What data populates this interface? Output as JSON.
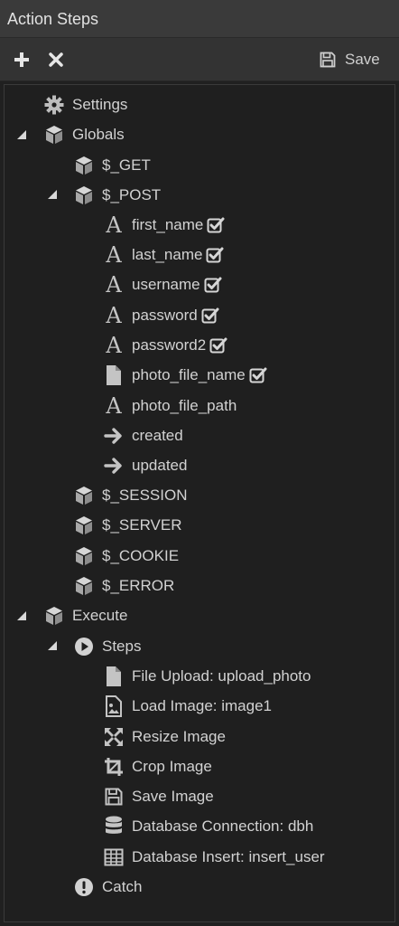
{
  "panel": {
    "title": "Action Steps"
  },
  "toolbar": {
    "save_label": "Save"
  },
  "tree": {
    "settings": "Settings",
    "globals": "Globals",
    "get": "$_GET",
    "post": "$_POST",
    "post_fields": [
      {
        "label": "first_name",
        "checked": true
      },
      {
        "label": "last_name",
        "checked": true
      },
      {
        "label": "username",
        "checked": true
      },
      {
        "label": "password",
        "checked": true
      },
      {
        "label": "password2",
        "checked": true
      },
      {
        "label": "photo_file_name",
        "checked": true
      },
      {
        "label": "photo_file_path",
        "checked": false
      },
      {
        "label": "created",
        "checked": false
      },
      {
        "label": "updated",
        "checked": false
      }
    ],
    "session": "$_SESSION",
    "server": "$_SERVER",
    "cookie": "$_COOKIE",
    "error": "$_ERROR",
    "execute": "Execute",
    "steps": "Steps",
    "step_items": [
      {
        "label": "File Upload: upload_photo",
        "icon": "file-icon"
      },
      {
        "label": "Load Image: image1",
        "icon": "image-icon"
      },
      {
        "label": "Resize Image",
        "icon": "resize-icon"
      },
      {
        "label": "Crop Image",
        "icon": "crop-icon"
      },
      {
        "label": "Save Image",
        "icon": "floppy-icon"
      },
      {
        "label": "Database Connection: dbh",
        "icon": "database-icon"
      },
      {
        "label": "Database Insert: insert_user",
        "icon": "table-icon"
      }
    ],
    "catch": "Catch"
  }
}
